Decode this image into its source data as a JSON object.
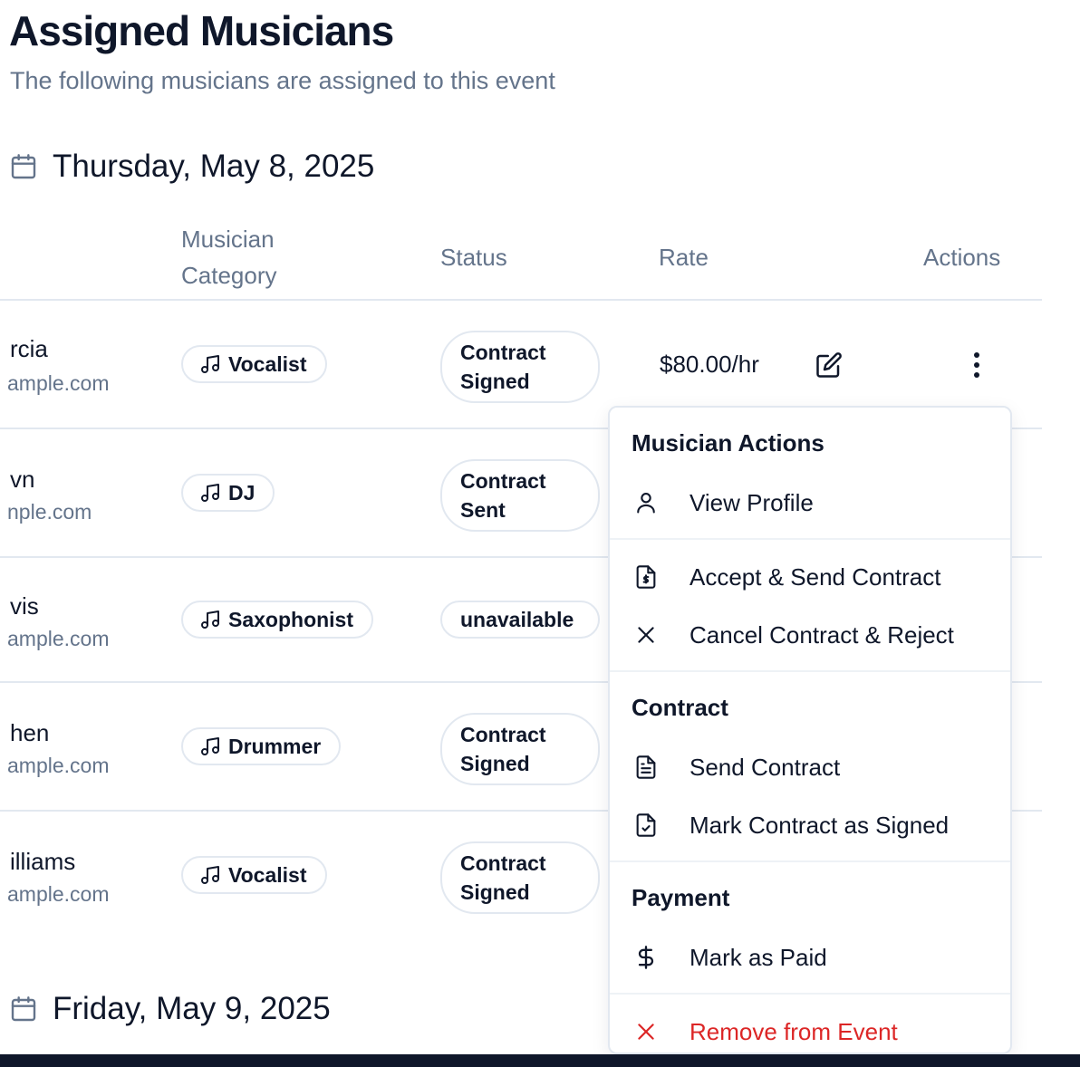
{
  "header": {
    "title": "Assigned Musicians",
    "subtitle": "The following musicians are assigned to this event"
  },
  "dates": [
    "Thursday, May 8, 2025",
    "Friday, May 9, 2025"
  ],
  "table": {
    "columns": {
      "category_line1": "Musician",
      "category_line2": "Category",
      "status": "Status",
      "rate": "Rate",
      "actions": "Actions"
    },
    "rows": [
      {
        "name": "rcia",
        "email": "ample.com",
        "category": "Vocalist",
        "status_line1": "Contract",
        "status_line2": "Signed",
        "rate": "$80.00/hr"
      },
      {
        "name": "vn",
        "email": "nple.com",
        "category": "DJ",
        "status_line1": "Contract",
        "status_line2": "Sent"
      },
      {
        "name": "vis",
        "email": "ample.com",
        "category": "Saxophonist",
        "status_line1": "unavailable",
        "status_line2": ""
      },
      {
        "name": "hen",
        "email": "ample.com",
        "category": "Drummer",
        "status_line1": "Contract",
        "status_line2": "Signed"
      },
      {
        "name": "illiams",
        "email": "ample.com",
        "category": "Vocalist",
        "status_line1": "Contract",
        "status_line2": "Signed"
      }
    ]
  },
  "menu": {
    "sections": {
      "musician_actions": "Musician Actions",
      "contract": "Contract",
      "payment": "Payment"
    },
    "items": {
      "view_profile": "View Profile",
      "accept_send": "Accept & Send Contract",
      "cancel_reject": "Cancel Contract & Reject",
      "send_contract": "Send Contract",
      "mark_signed": "Mark Contract as Signed",
      "mark_paid": "Mark as Paid",
      "remove": "Remove from Event"
    },
    "icons": {
      "view_profile": "user-icon",
      "accept_send": "file-dollar-icon",
      "cancel_reject": "x-icon",
      "send_contract": "file-text-icon",
      "mark_signed": "file-check-icon",
      "mark_paid": "dollar-icon",
      "remove": "x-icon"
    },
    "danger_color": "#dc2626"
  },
  "colors": {
    "text": "#0f172a",
    "muted": "#64748b",
    "border": "#e2e8f0"
  }
}
